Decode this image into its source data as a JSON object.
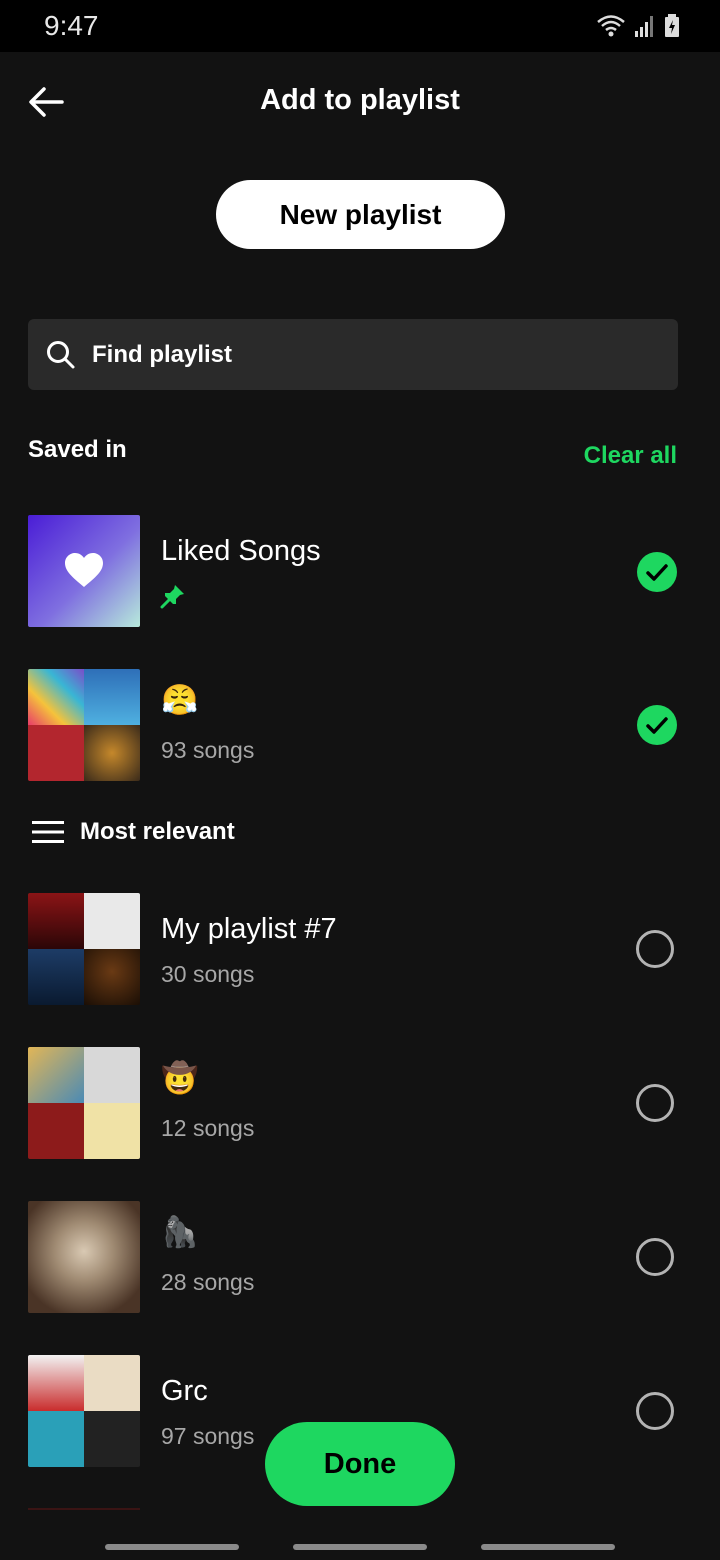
{
  "status": {
    "time": "9:47"
  },
  "header": {
    "title": "Add to playlist"
  },
  "actions": {
    "new_playlist": "New playlist",
    "done": "Done"
  },
  "search": {
    "placeholder": "Find playlist"
  },
  "saved": {
    "label": "Saved in",
    "clear_all": "Clear all",
    "items": [
      {
        "title": "Liked Songs",
        "sub": "",
        "checked": true
      },
      {
        "title": "😤",
        "sub": "93 songs",
        "checked": true
      }
    ]
  },
  "relevant": {
    "label": "Most relevant",
    "items": [
      {
        "title": "My playlist #7",
        "sub": "30 songs",
        "checked": false
      },
      {
        "title": "🤠",
        "sub": "12 songs",
        "checked": false
      },
      {
        "title": "🦍",
        "sub": "28 songs",
        "checked": false
      },
      {
        "title": "Grc",
        "sub": "97 songs",
        "checked": false
      }
    ]
  },
  "colors": {
    "accent": "#1ed760",
    "background": "#121212"
  }
}
